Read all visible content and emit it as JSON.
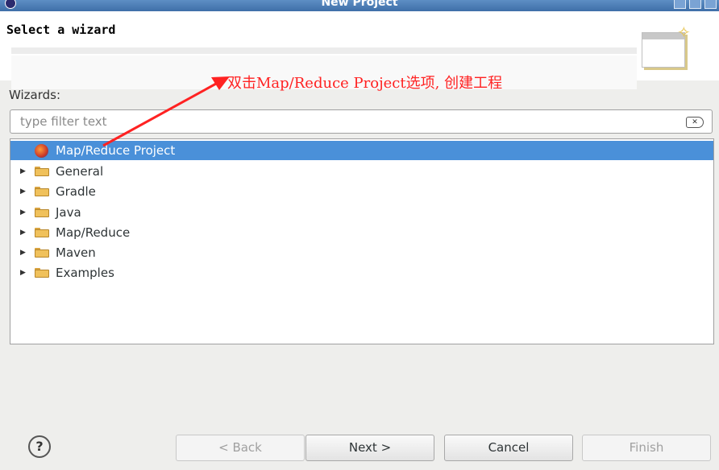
{
  "window": {
    "title": "New Project"
  },
  "header": {
    "title": "Select a wizard"
  },
  "wizards": {
    "label": "Wizards:",
    "filter_placeholder": "type filter text",
    "items": [
      {
        "label": "Map/Reduce Project",
        "selected": true,
        "expandable": false,
        "icon": "mapreduce-project-icon"
      },
      {
        "label": "General",
        "selected": false,
        "expandable": true,
        "icon": "folder-icon"
      },
      {
        "label": "Gradle",
        "selected": false,
        "expandable": true,
        "icon": "folder-icon"
      },
      {
        "label": "Java",
        "selected": false,
        "expandable": true,
        "icon": "folder-icon"
      },
      {
        "label": "Map/Reduce",
        "selected": false,
        "expandable": true,
        "icon": "folder-icon"
      },
      {
        "label": "Maven",
        "selected": false,
        "expandable": true,
        "icon": "folder-icon"
      },
      {
        "label": "Examples",
        "selected": false,
        "expandable": true,
        "icon": "folder-icon"
      }
    ]
  },
  "annotation": {
    "text": "双击Map/Reduce Project选项, 创建工程",
    "color": "#ff2222"
  },
  "buttons": {
    "back": "< Back",
    "next": "Next >",
    "cancel": "Cancel",
    "finish": "Finish"
  },
  "colors": {
    "selection": "#4a90d9",
    "titlebar": "#4a7bb7"
  }
}
